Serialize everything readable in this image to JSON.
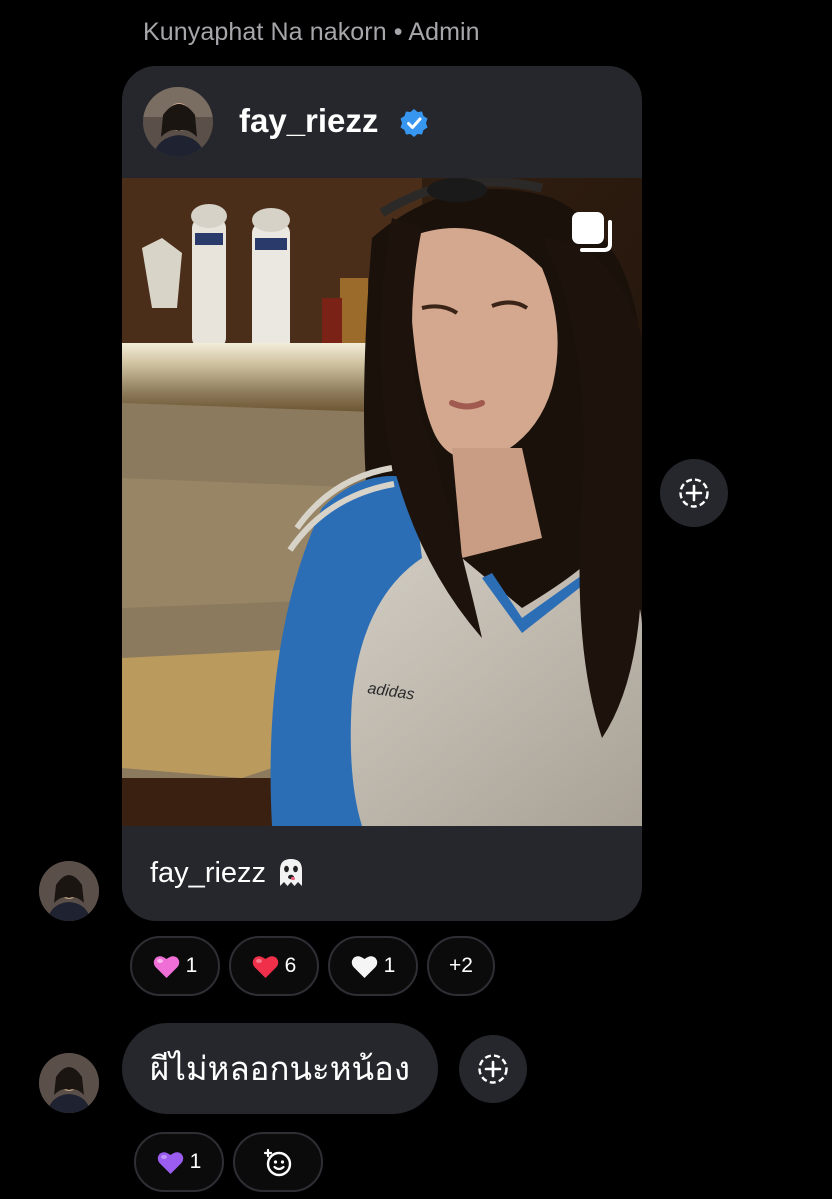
{
  "sender": {
    "name": "Kunyaphat Na nakorn",
    "separator": " • ",
    "role": "Admin"
  },
  "shared_post": {
    "username": "fay_riezz",
    "verified": true,
    "caption_user": "fay_riezz",
    "caption_emoji": "ghost",
    "is_multi_photo": true
  },
  "post_reactions": [
    {
      "emoji": "pink-heart",
      "color": "#f06fd7",
      "count": "1"
    },
    {
      "emoji": "red-heart",
      "color": "#f0304a",
      "count": "6"
    },
    {
      "emoji": "white-heart",
      "color": "#f5f5f5",
      "count": "1"
    },
    {
      "emoji": "",
      "color": "",
      "count": "+2"
    }
  ],
  "message": {
    "text": "ผีไม่หลอกนะหน้อง"
  },
  "message_reactions": [
    {
      "emoji": "purple-heart",
      "color": "#9b5cf0",
      "count": "1"
    }
  ],
  "colors": {
    "bubble": "#26272c",
    "background": "#000000",
    "verified": "#3797f0"
  }
}
